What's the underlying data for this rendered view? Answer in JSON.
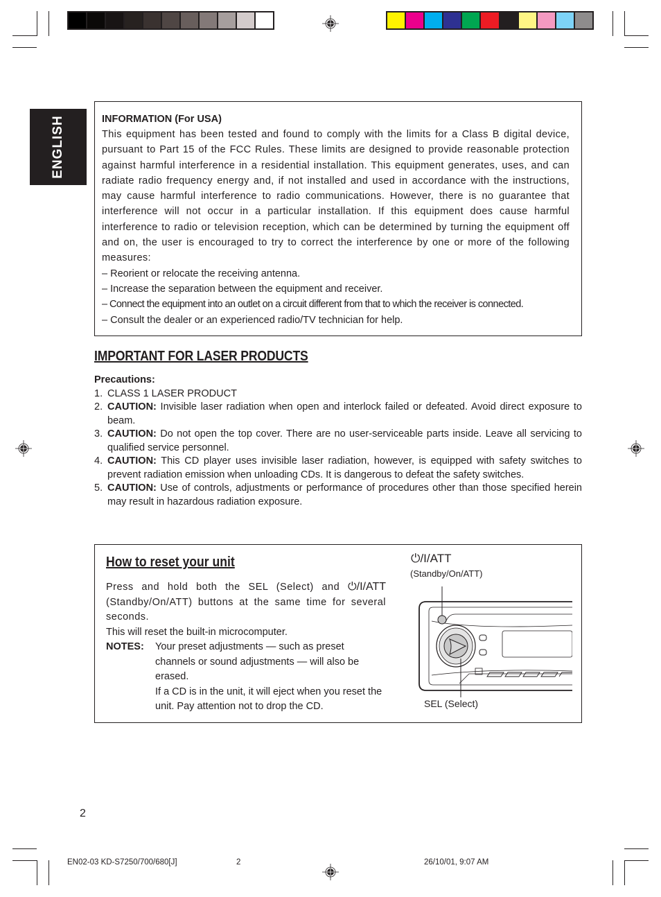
{
  "print_marks": {
    "grayscale_swatches": [
      "#000000",
      "#0b0908",
      "#181414",
      "#272220",
      "#3a3230",
      "#4f4644",
      "#685e5c",
      "#837978",
      "#a69e9d",
      "#d3cbcb",
      "#ffffff"
    ],
    "color_swatches": [
      "#fff200",
      "#ec008c",
      "#00aeef",
      "#2e3192",
      "#00a651",
      "#ed1c24",
      "#231f20",
      "#fff685",
      "#f49ac1",
      "#7dd3f7",
      "#8e8c8c"
    ]
  },
  "language_tab": "ENGLISH",
  "fcc_info": {
    "title": "INFORMATION (For USA)",
    "body": "This equipment has been tested and found to comply with the limits for a Class B digital device, pursuant to Part 15 of the FCC Rules. These limits are designed to provide reasonable protection against harmful interference in a residential installation. This equipment generates, uses, and can radiate radio frequency energy and, if not installed and used in accordance with the instructions, may cause harmful interference to radio communications. However, there is no guarantee that interference will not occur in a particular installation. If this equipment does cause harmful interference to radio or television reception, which can be determined by turning the equipment off and on, the user is encouraged to try to correct the interference by one or more of the following measures:",
    "measures": [
      "– Reorient or relocate the receiving antenna.",
      "– Increase the separation between the equipment and receiver.",
      "– Connect the equipment into an outlet on a circuit different from that to which the receiver is connected.",
      "– Consult the dealer or an experienced radio/TV technician for help."
    ]
  },
  "laser": {
    "heading": "IMPORTANT FOR LASER PRODUCTS",
    "precautions_label": "Precautions:",
    "items": [
      {
        "num": "1.",
        "label": "",
        "text": "CLASS 1 LASER PRODUCT"
      },
      {
        "num": "2.",
        "label": "CAUTION:",
        "text": " Invisible laser radiation when open and interlock failed or defeated. Avoid direct exposure to beam."
      },
      {
        "num": "3.",
        "label": "CAUTION:",
        "text": " Do not open the top cover. There are no user-serviceable parts inside. Leave all servicing to qualified service personnel."
      },
      {
        "num": "4.",
        "label": "CAUTION:",
        "text": " This CD player uses invisible laser radiation, however, is equipped with safety switches to prevent radiation emission when unloading CDs. It is dangerous to defeat the safety switches."
      },
      {
        "num": "5.",
        "label": "CAUTION:",
        "text": " Use of controls, adjustments or performance of procedures other than those specified herein may result in hazardous radiation exposure."
      }
    ]
  },
  "reset": {
    "heading": "How to reset your unit",
    "instruction_pre": "Press and hold both the SEL (Select) and ",
    "button_symbol": "⏻/I/ATT",
    "instruction_post": " (Standby/On/ATT) buttons at the same time for several seconds.",
    "result": "This will reset the built-in microcomputer.",
    "notes_label": "NOTES:",
    "notes": [
      "Your preset adjustments — such as preset channels or sound adjustments — will also be erased.",
      "If a CD is in the unit, it will eject when you reset the unit. Pay attention not to drop the CD."
    ],
    "diagram": {
      "power_label": "⏻/I/ATT",
      "power_sublabel": "(Standby/On/ATT)",
      "sel_label": "SEL (Select)"
    }
  },
  "page_number": "2",
  "footer": {
    "file": "EN02-03 KD-S7250/700/680[J]",
    "page": "2",
    "timestamp": "26/10/01, 9:07 AM"
  }
}
